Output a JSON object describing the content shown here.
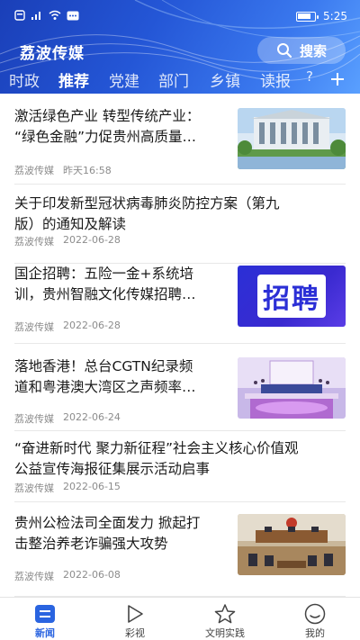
{
  "status_bar": {
    "time": "5:25"
  },
  "header": {
    "app_title": "荔波传媒",
    "search_label": "搜索"
  },
  "tabs": [
    {
      "label": "时政"
    },
    {
      "label": "推荐",
      "active": true
    },
    {
      "label": "党建"
    },
    {
      "label": "部门"
    },
    {
      "label": "乡镇"
    },
    {
      "label": "读报"
    }
  ],
  "articles": [
    {
      "title_line1": "激活绿色产业 转型传统产业：",
      "title_line2": "“绿色金融”力促贵州高质量…",
      "source": "荔波传媒",
      "date": "昨天16:58",
      "thumb": "building-photo"
    },
    {
      "title_line1": "关于印发新型冠状病毒肺炎防控方案（第九",
      "title_line2": "版）的通知及解读",
      "source": "荔波传媒",
      "date": "2022-06-28"
    },
    {
      "title_line1": "国企招聘：五险一金+系统培",
      "title_line2": "训，贵州智融文化传媒招聘…",
      "source": "荔波传媒",
      "date": "2022-06-28",
      "thumb": "recruit-banner",
      "thumb_text": "招聘"
    },
    {
      "title_line1": "落地香港！总台CGTN纪录频",
      "title_line2": "道和粤港澳大湾区之声频率…",
      "source": "荔波传媒",
      "date": "2022-06-24",
      "thumb": "event-stage-photo"
    },
    {
      "title_line1": "“奋进新时代 聚力新征程”社会主义核心价值观",
      "title_line2": "公益宣传海报征集展示活动启事",
      "source": "荔波传媒",
      "date": "2022-06-15"
    },
    {
      "title_line1": "贵州公检法司全面发力 掀起打",
      "title_line2": "击整治养老诈骗强大攻势",
      "source": "荔波传媒",
      "date": "2022-06-08",
      "thumb": "courtroom-photo"
    }
  ],
  "bottom_nav": [
    {
      "label": "新闻",
      "icon": "news-icon",
      "active": true
    },
    {
      "label": "彩视",
      "icon": "play-icon"
    },
    {
      "label": "文明实践",
      "icon": "star-icon"
    },
    {
      "label": "我的",
      "icon": "profile-icon"
    }
  ],
  "colors": {
    "accent": "#2a64e0",
    "header": "#2456d6"
  }
}
